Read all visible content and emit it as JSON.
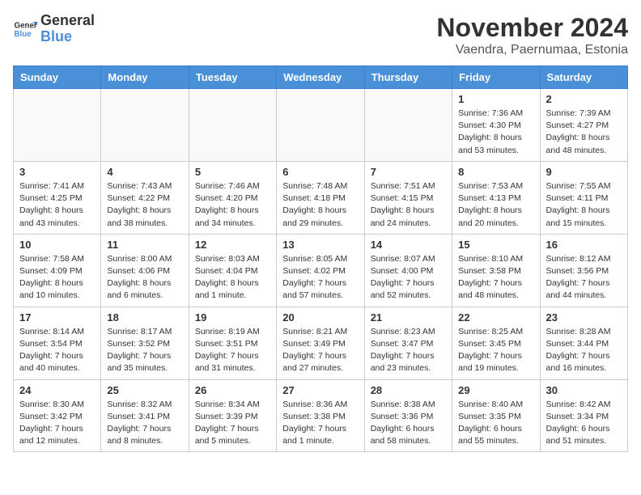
{
  "header": {
    "logo_line1": "General",
    "logo_line2": "Blue",
    "month": "November 2024",
    "location": "Vaendra, Paernumaa, Estonia"
  },
  "columns": [
    "Sunday",
    "Monday",
    "Tuesday",
    "Wednesday",
    "Thursday",
    "Friday",
    "Saturday"
  ],
  "weeks": [
    [
      {
        "day": "",
        "info": ""
      },
      {
        "day": "",
        "info": ""
      },
      {
        "day": "",
        "info": ""
      },
      {
        "day": "",
        "info": ""
      },
      {
        "day": "",
        "info": ""
      },
      {
        "day": "1",
        "info": "Sunrise: 7:36 AM\nSunset: 4:30 PM\nDaylight: 8 hours\nand 53 minutes."
      },
      {
        "day": "2",
        "info": "Sunrise: 7:39 AM\nSunset: 4:27 PM\nDaylight: 8 hours\nand 48 minutes."
      }
    ],
    [
      {
        "day": "3",
        "info": "Sunrise: 7:41 AM\nSunset: 4:25 PM\nDaylight: 8 hours\nand 43 minutes."
      },
      {
        "day": "4",
        "info": "Sunrise: 7:43 AM\nSunset: 4:22 PM\nDaylight: 8 hours\nand 38 minutes."
      },
      {
        "day": "5",
        "info": "Sunrise: 7:46 AM\nSunset: 4:20 PM\nDaylight: 8 hours\nand 34 minutes."
      },
      {
        "day": "6",
        "info": "Sunrise: 7:48 AM\nSunset: 4:18 PM\nDaylight: 8 hours\nand 29 minutes."
      },
      {
        "day": "7",
        "info": "Sunrise: 7:51 AM\nSunset: 4:15 PM\nDaylight: 8 hours\nand 24 minutes."
      },
      {
        "day": "8",
        "info": "Sunrise: 7:53 AM\nSunset: 4:13 PM\nDaylight: 8 hours\nand 20 minutes."
      },
      {
        "day": "9",
        "info": "Sunrise: 7:55 AM\nSunset: 4:11 PM\nDaylight: 8 hours\nand 15 minutes."
      }
    ],
    [
      {
        "day": "10",
        "info": "Sunrise: 7:58 AM\nSunset: 4:09 PM\nDaylight: 8 hours\nand 10 minutes."
      },
      {
        "day": "11",
        "info": "Sunrise: 8:00 AM\nSunset: 4:06 PM\nDaylight: 8 hours\nand 6 minutes."
      },
      {
        "day": "12",
        "info": "Sunrise: 8:03 AM\nSunset: 4:04 PM\nDaylight: 8 hours\nand 1 minute."
      },
      {
        "day": "13",
        "info": "Sunrise: 8:05 AM\nSunset: 4:02 PM\nDaylight: 7 hours\nand 57 minutes."
      },
      {
        "day": "14",
        "info": "Sunrise: 8:07 AM\nSunset: 4:00 PM\nDaylight: 7 hours\nand 52 minutes."
      },
      {
        "day": "15",
        "info": "Sunrise: 8:10 AM\nSunset: 3:58 PM\nDaylight: 7 hours\nand 48 minutes."
      },
      {
        "day": "16",
        "info": "Sunrise: 8:12 AM\nSunset: 3:56 PM\nDaylight: 7 hours\nand 44 minutes."
      }
    ],
    [
      {
        "day": "17",
        "info": "Sunrise: 8:14 AM\nSunset: 3:54 PM\nDaylight: 7 hours\nand 40 minutes."
      },
      {
        "day": "18",
        "info": "Sunrise: 8:17 AM\nSunset: 3:52 PM\nDaylight: 7 hours\nand 35 minutes."
      },
      {
        "day": "19",
        "info": "Sunrise: 8:19 AM\nSunset: 3:51 PM\nDaylight: 7 hours\nand 31 minutes."
      },
      {
        "day": "20",
        "info": "Sunrise: 8:21 AM\nSunset: 3:49 PM\nDaylight: 7 hours\nand 27 minutes."
      },
      {
        "day": "21",
        "info": "Sunrise: 8:23 AM\nSunset: 3:47 PM\nDaylight: 7 hours\nand 23 minutes."
      },
      {
        "day": "22",
        "info": "Sunrise: 8:25 AM\nSunset: 3:45 PM\nDaylight: 7 hours\nand 19 minutes."
      },
      {
        "day": "23",
        "info": "Sunrise: 8:28 AM\nSunset: 3:44 PM\nDaylight: 7 hours\nand 16 minutes."
      }
    ],
    [
      {
        "day": "24",
        "info": "Sunrise: 8:30 AM\nSunset: 3:42 PM\nDaylight: 7 hours\nand 12 minutes."
      },
      {
        "day": "25",
        "info": "Sunrise: 8:32 AM\nSunset: 3:41 PM\nDaylight: 7 hours\nand 8 minutes."
      },
      {
        "day": "26",
        "info": "Sunrise: 8:34 AM\nSunset: 3:39 PM\nDaylight: 7 hours\nand 5 minutes."
      },
      {
        "day": "27",
        "info": "Sunrise: 8:36 AM\nSunset: 3:38 PM\nDaylight: 7 hours\nand 1 minute."
      },
      {
        "day": "28",
        "info": "Sunrise: 8:38 AM\nSunset: 3:36 PM\nDaylight: 6 hours\nand 58 minutes."
      },
      {
        "day": "29",
        "info": "Sunrise: 8:40 AM\nSunset: 3:35 PM\nDaylight: 6 hours\nand 55 minutes."
      },
      {
        "day": "30",
        "info": "Sunrise: 8:42 AM\nSunset: 3:34 PM\nDaylight: 6 hours\nand 51 minutes."
      }
    ]
  ]
}
